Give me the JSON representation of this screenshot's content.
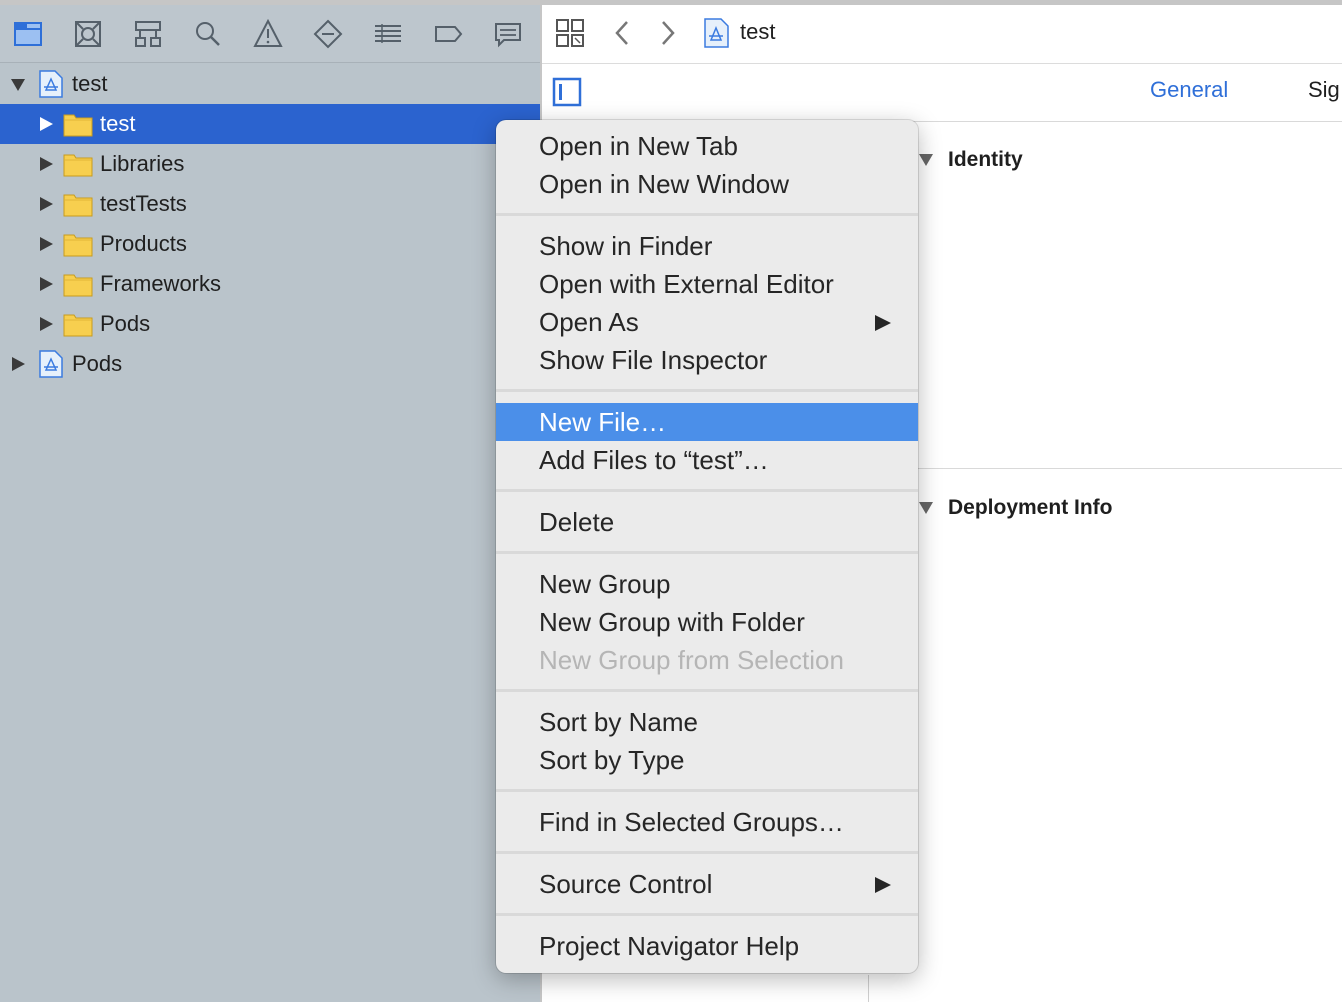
{
  "navigator": {
    "toolbar_icons": [
      "project-navigator-icon",
      "source-control-icon",
      "symbol-navigator-icon",
      "find-icon",
      "issue-warning-icon",
      "test-navigator-icon",
      "debug-list-icon",
      "breakpoint-icon",
      "report-icon"
    ],
    "tree": [
      {
        "label": "test",
        "level": 0,
        "expanded": true,
        "kind": "project"
      },
      {
        "label": "test",
        "level": 1,
        "expanded": false,
        "kind": "folder",
        "selected": true
      },
      {
        "label": "Libraries",
        "level": 1,
        "expanded": false,
        "kind": "folder"
      },
      {
        "label": "testTests",
        "level": 1,
        "expanded": false,
        "kind": "folder"
      },
      {
        "label": "Products",
        "level": 1,
        "expanded": false,
        "kind": "folder"
      },
      {
        "label": "Frameworks",
        "level": 1,
        "expanded": false,
        "kind": "folder"
      },
      {
        "label": "Pods",
        "level": 1,
        "expanded": false,
        "kind": "folder"
      },
      {
        "label": "Pods",
        "level": 0,
        "expanded": false,
        "kind": "project"
      }
    ]
  },
  "editor": {
    "jump_bar_label": "test",
    "tabs": {
      "general": "General",
      "signing": "Sig"
    },
    "sections": {
      "identity": "Identity",
      "deployment": "Deployment Info"
    }
  },
  "context_menu": {
    "groups": [
      [
        {
          "label": "Open in New Tab"
        },
        {
          "label": "Open in New Window"
        }
      ],
      [
        {
          "label": "Show in Finder"
        },
        {
          "label": "Open with External Editor"
        },
        {
          "label": "Open As",
          "submenu": true
        },
        {
          "label": "Show File Inspector"
        }
      ],
      [
        {
          "label": "New File…",
          "highlighted": true
        },
        {
          "label": "Add Files to “test”…"
        }
      ],
      [
        {
          "label": "Delete"
        }
      ],
      [
        {
          "label": "New Group"
        },
        {
          "label": "New Group with Folder"
        },
        {
          "label": "New Group from Selection",
          "disabled": true
        }
      ],
      [
        {
          "label": "Sort by Name"
        },
        {
          "label": "Sort by Type"
        }
      ],
      [
        {
          "label": "Find in Selected Groups…"
        }
      ],
      [
        {
          "label": "Source Control",
          "submenu": true
        }
      ],
      [
        {
          "label": "Project Navigator Help"
        }
      ]
    ]
  },
  "colors": {
    "selection": "#2b63cf",
    "menu_highlight": "#4b8fe9",
    "accent_tab": "#2f6fd8",
    "folder": "#f7cf4f"
  }
}
